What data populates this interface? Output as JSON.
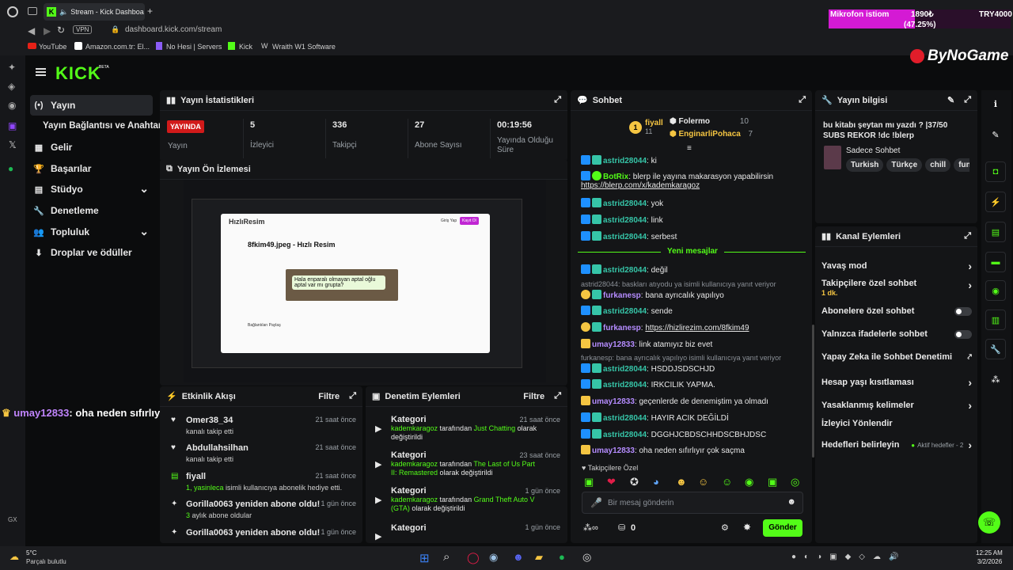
{
  "browser": {
    "tab_title": "Stream - Kick Dashboa",
    "new_tab": "+",
    "address": "dashboard.kick.com/stream",
    "vpn": "VPN",
    "bookmarks": [
      "YouTube",
      "Amazon.com.tr: El...",
      "No Hesi | Servers",
      "Kick",
      "Wraith W1 Software"
    ]
  },
  "overlay": {
    "goal_label": "Mikrofon istiom",
    "goal_value": "1890₺",
    "goal_percent": "(47.25%)",
    "goal_target": "TRY4000",
    "goal_progress": 0.4725,
    "brand": "ByNoGame",
    "overlay_chat": {
      "user": "umay12833",
      "message": ": oha neden sıfırlıyır çok saçma"
    }
  },
  "sidebar": {
    "logo": "KICK",
    "beta": "BETA",
    "items": [
      {
        "label": "Yayın",
        "icon": "(•)"
      },
      {
        "label": "Yayın Bağlantısı ve Anahtarı",
        "icon": ""
      },
      {
        "label": "Gelir",
        "icon": "▦"
      },
      {
        "label": "Başarılar",
        "icon": "🏆"
      },
      {
        "label": "Stüdyo",
        "icon": "▤"
      },
      {
        "label": "Denetleme",
        "icon": "🔧"
      },
      {
        "label": "Topluluk",
        "icon": "👥"
      },
      {
        "label": "Droplar ve ödüller",
        "icon": "⬇"
      }
    ],
    "chevron": "⌄"
  },
  "stats": {
    "title": "Yayın İstatistikleri",
    "live_badge": "YAYINDA",
    "live_label": "Yayın",
    "items": [
      {
        "value": "5",
        "label": "İzleyici"
      },
      {
        "value": "336",
        "label": "Takipçi"
      },
      {
        "value": "27",
        "label": "Abone Sayısı"
      },
      {
        "value": "00:19:56",
        "label": "Yayında Olduğu Süre"
      }
    ]
  },
  "preview": {
    "title": "Yayın Ön İzlemesi",
    "page_title": "8fkim49.jpeg - Hızlı Resim",
    "site": "HızlıResim",
    "bubble": "Hala enparalı olmayan aptal oğlu aptal var mı grupta?",
    "share": "Bağlantıları Paylaş",
    "login": "Giriş Yap",
    "register": "Kayıt Ol"
  },
  "activity": {
    "title": "Etkinlik Akışı",
    "filter": "Filtre",
    "items": [
      {
        "name": "Omer38_34",
        "sub": "kanalı takip etti",
        "time": "21 saat önce"
      },
      {
        "name": "Abdullahsilhan",
        "sub": "kanalı takip etti",
        "time": "21 saat önce"
      },
      {
        "name": "fiyall",
        "sub_hl": "1, yasinleca",
        "sub": " isimli kullanıcıya abonelik hediye etti.",
        "time": "21 saat önce"
      },
      {
        "name": "Gorilla0063 yeniden abone oldu!",
        "sub_hl": "3",
        "sub": " aylık abone oldular",
        "time": "1 gün önce"
      },
      {
        "name": "Gorilla0063 yeniden abone oldu!",
        "sub": "",
        "time": "1 gün önce"
      }
    ]
  },
  "moderation": {
    "title": "Denetim Eylemleri",
    "filter": "Filtre",
    "items": [
      {
        "name": "Kategori",
        "who": "kademkaragoz",
        "mid": " tarafından ",
        "game": "Just Chatting",
        "end": " olarak değiştirildi",
        "time": "21 saat önce"
      },
      {
        "name": "Kategori",
        "who": "kademkaragoz",
        "mid": " tarafından ",
        "game": "The Last of Us Part II: Remastered",
        "end": " olarak değiştirildi",
        "time": "23 saat önce"
      },
      {
        "name": "Kategori",
        "who": "kademkaragoz",
        "mid": " tarafından ",
        "game": "Grand Theft Auto V (GTA)",
        "end": " olarak değiştirildi",
        "time": "1 gün önce"
      },
      {
        "name": "Kategori",
        "who": "",
        "mid": "",
        "game": "",
        "end": "",
        "time": "1 gün önce"
      }
    ]
  },
  "chat": {
    "title": "Sohbet",
    "top": [
      {
        "rank": "1",
        "name": "fiyall",
        "count": "11"
      },
      {
        "name": "Folermo",
        "count": "10"
      },
      {
        "name": "EnginarliPohaca",
        "count": "7"
      }
    ],
    "lines": [
      {
        "user": "astrid28044",
        "text": ": ki",
        "color": "teal"
      },
      {
        "user": "BotRix",
        "text": ": blerp ile yayına makarasyon yapabilirsin",
        "link": "https://blerp.com/x/kademkaragoz",
        "color": "green"
      },
      {
        "user": "astrid28044",
        "text": ": yok",
        "color": "teal"
      },
      {
        "user": "astrid28044",
        "text": ": link",
        "color": "teal"
      },
      {
        "user": "astrid28044",
        "text": ": serbest",
        "color": "teal"
      }
    ],
    "new_messages": "Yeni mesajlar",
    "lines2": [
      {
        "user": "astrid28044",
        "text": ": değil",
        "color": "teal"
      },
      {
        "notice": "astrid28044: baskları atıyodu ya isimli kullanıcıya yanıt veriyor"
      },
      {
        "user": "furkanesp",
        "text": ": bana ayrıcalık yapılıyo",
        "color": "purple"
      },
      {
        "user": "astrid28044",
        "text": ": sende",
        "color": "teal"
      },
      {
        "user": "furkanesp",
        "text": ": ",
        "link": "https://hizlirezim.com/8fkim49",
        "color": "purple"
      },
      {
        "user": "umay12833",
        "text": ": link atamıyız biz evet",
        "color": "purple"
      },
      {
        "notice": "furkanesp: bana ayrıcalık yapılıyo isimli kullanıcıya yanıt veriyor"
      },
      {
        "user": "astrid28044",
        "text": ": HSDDJSDSCHJD",
        "color": "teal"
      },
      {
        "user": "astrid28044",
        "text": ": IRKCILIK YAPMA.",
        "color": "teal"
      },
      {
        "user": "umay12833",
        "text": ": geçenlerde de denemiştim ya olmadı",
        "color": "purple"
      },
      {
        "user": "astrid28044",
        "text": ": HAYIR ACIK DEĞİLDİ",
        "color": "teal"
      },
      {
        "user": "astrid28044",
        "text": ": DGGHJCBDSCHHDSCBHJDSC",
        "color": "teal"
      },
      {
        "user": "umay12833",
        "text": ": oha neden sıfırlıyır çok saçma",
        "color": "purple"
      }
    ],
    "followers_only": "Takipçilere Özel",
    "placeholder": "Bir mesaj gönderin",
    "points": "0",
    "send": "Gönder"
  },
  "stream_info": {
    "title": "Yayın bilgisi",
    "stream_title": "bu kitabı şeytan mı yazdı ? |37/50 SUBS REKOR !dc !blerp",
    "category": "Sadece Sohbet",
    "tags": [
      "Turkish",
      "Türkçe",
      "chill",
      "funn"
    ]
  },
  "channel": {
    "title": "Kanal Eylemleri",
    "items": [
      {
        "label": "Yavaş mod",
        "ctrl": "chevron"
      },
      {
        "label": "Takipçilere özel sohbet",
        "sub": "1 dk.",
        "ctrl": "chevron"
      },
      {
        "label": "Abonelere özel sohbet",
        "ctrl": "toggle"
      },
      {
        "label": "Yalnızca ifadelerle sohbet",
        "ctrl": "toggle"
      },
      {
        "label": "Yapay Zeka ile Sohbet Denetimi",
        "ctrl": "external"
      },
      {
        "label": "Hesap yaşı kısıtlaması",
        "ctrl": "chevron"
      },
      {
        "label": "Yasaklanmış kelimeler",
        "ctrl": "chevron"
      },
      {
        "label": "İzleyici Yönlendir",
        "ctrl": "none"
      },
      {
        "label": "Hedefleri belirleyin",
        "extra": "Aktif hedefler - 2",
        "ctrl": "chevron"
      }
    ]
  },
  "taskbar": {
    "temp": "5°C",
    "weather": "Parçalı bulutlu",
    "time": "12:25 AM",
    "date": "3/2/2026",
    "gx": "GX"
  }
}
